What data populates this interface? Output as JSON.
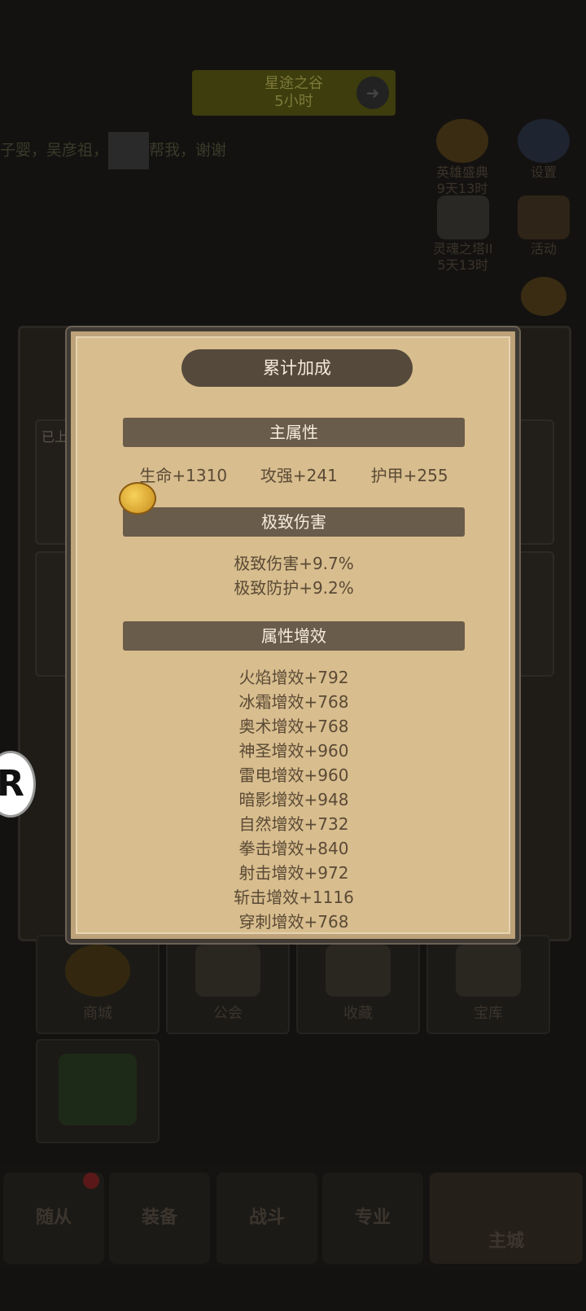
{
  "background": {
    "banner": {
      "line1": "星途之谷",
      "line2": "5小时"
    },
    "scroll_text_pre": "子婴，吴彦祖，",
    "scroll_text_post": "帮我，谢谢",
    "side": [
      {
        "label1": "英雄盛典",
        "label2": "9天13时"
      },
      {
        "label1": "设置",
        "label2": ""
      },
      {
        "label1": "灵魂之塔II",
        "label2": "5天13时"
      },
      {
        "label1": "活动",
        "label2": ""
      }
    ],
    "card_tag": "已上",
    "grid": [
      "商城",
      "公会",
      "收藏",
      "宝库"
    ],
    "nav": [
      "随从",
      "装备",
      "战斗",
      "专业",
      "主城"
    ],
    "r_glyph": "R"
  },
  "dialog": {
    "title": "累计加成",
    "sections": [
      {
        "header": "主属性",
        "stats": [
          "生命+1310",
          "攻强+241",
          "护甲+255"
        ]
      },
      {
        "header": "极致伤害",
        "lines": [
          "极致伤害+9.7%",
          "极致防护+9.2%"
        ]
      },
      {
        "header": "属性增效",
        "lines": [
          "火焰增效+792",
          "冰霜增效+768",
          "奥术增效+768",
          "神圣增效+960",
          "雷电增效+960",
          "暗影增效+948",
          "自然增效+732",
          "拳击增效+840",
          "射击增效+972",
          "斩击增效+1116",
          "穿刺增效+768"
        ]
      }
    ]
  },
  "colors": {
    "parchment": "#d8bd8e",
    "header_bg": "#6a5c4a",
    "title_bg": "#55493c",
    "text": "#5a4a36"
  }
}
